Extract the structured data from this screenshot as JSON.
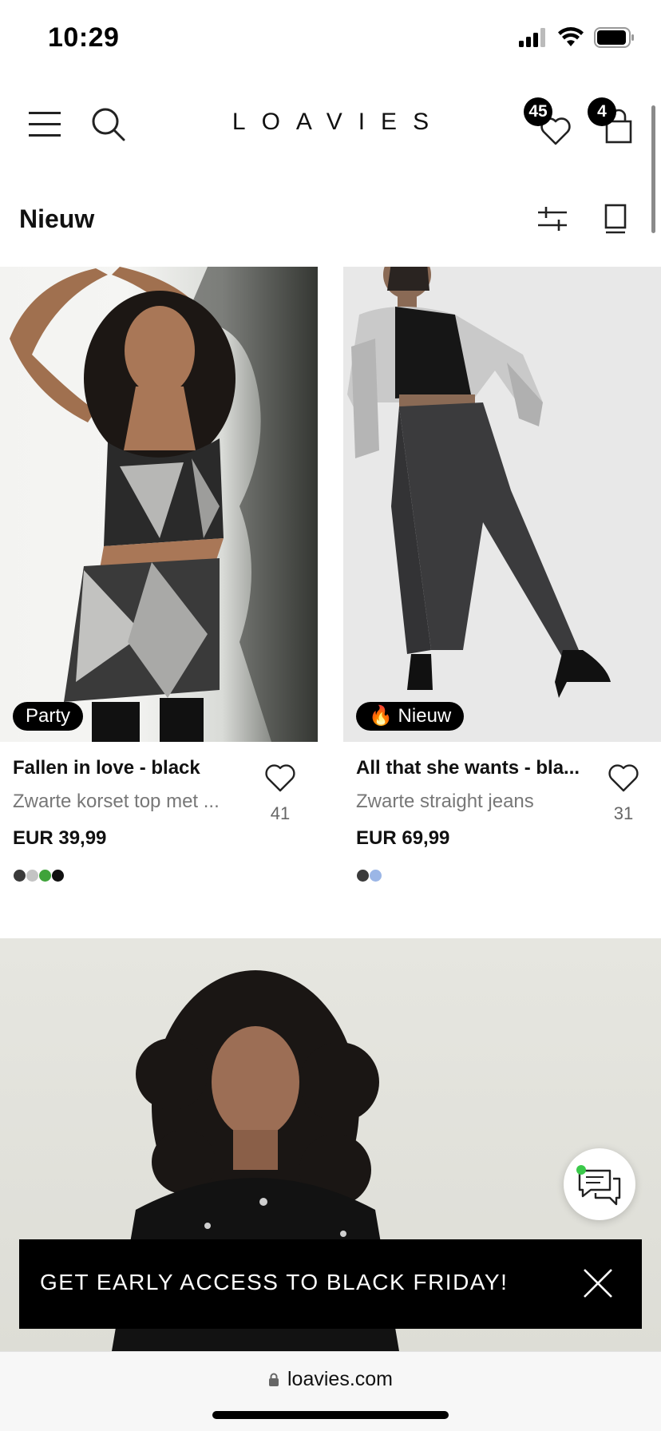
{
  "status_bar": {
    "time": "10:29",
    "icons": [
      "cellular-signal-icon",
      "wifi-icon",
      "battery-icon"
    ]
  },
  "header": {
    "logo": "LOAVIES",
    "wishlist_count": "45",
    "cart_count": "4",
    "icons": [
      "hamburger-menu-icon",
      "search-icon",
      "heart-icon",
      "shopping-bag-icon"
    ]
  },
  "section": {
    "title": "Nieuw",
    "icons": [
      "filter-sliders-icon",
      "single-column-view-icon"
    ]
  },
  "products": [
    {
      "tag": "Party",
      "name": "Fallen in love - black",
      "description": "Zwarte korset top met ...",
      "price": "EUR 39,99",
      "likes": "41",
      "swatches": [
        "#3a3a3a",
        "#c4c4c4",
        "#3fa33a",
        "#111111"
      ]
    },
    {
      "tag": "🔥 Nieuw",
      "name": "All that she wants - bla...",
      "description": "Zwarte straight jeans",
      "price": "EUR 69,99",
      "likes": "31",
      "swatches": [
        "#3a3a3a",
        "#9bb6e6"
      ]
    }
  ],
  "promo": {
    "text": "GET EARLY ACCESS TO BLACK FRIDAY!"
  },
  "browser": {
    "url": "loavies.com"
  },
  "colors": {
    "brand_black": "#000000",
    "text_grey": "#777777",
    "chat_status_green": "#3ac94a"
  }
}
